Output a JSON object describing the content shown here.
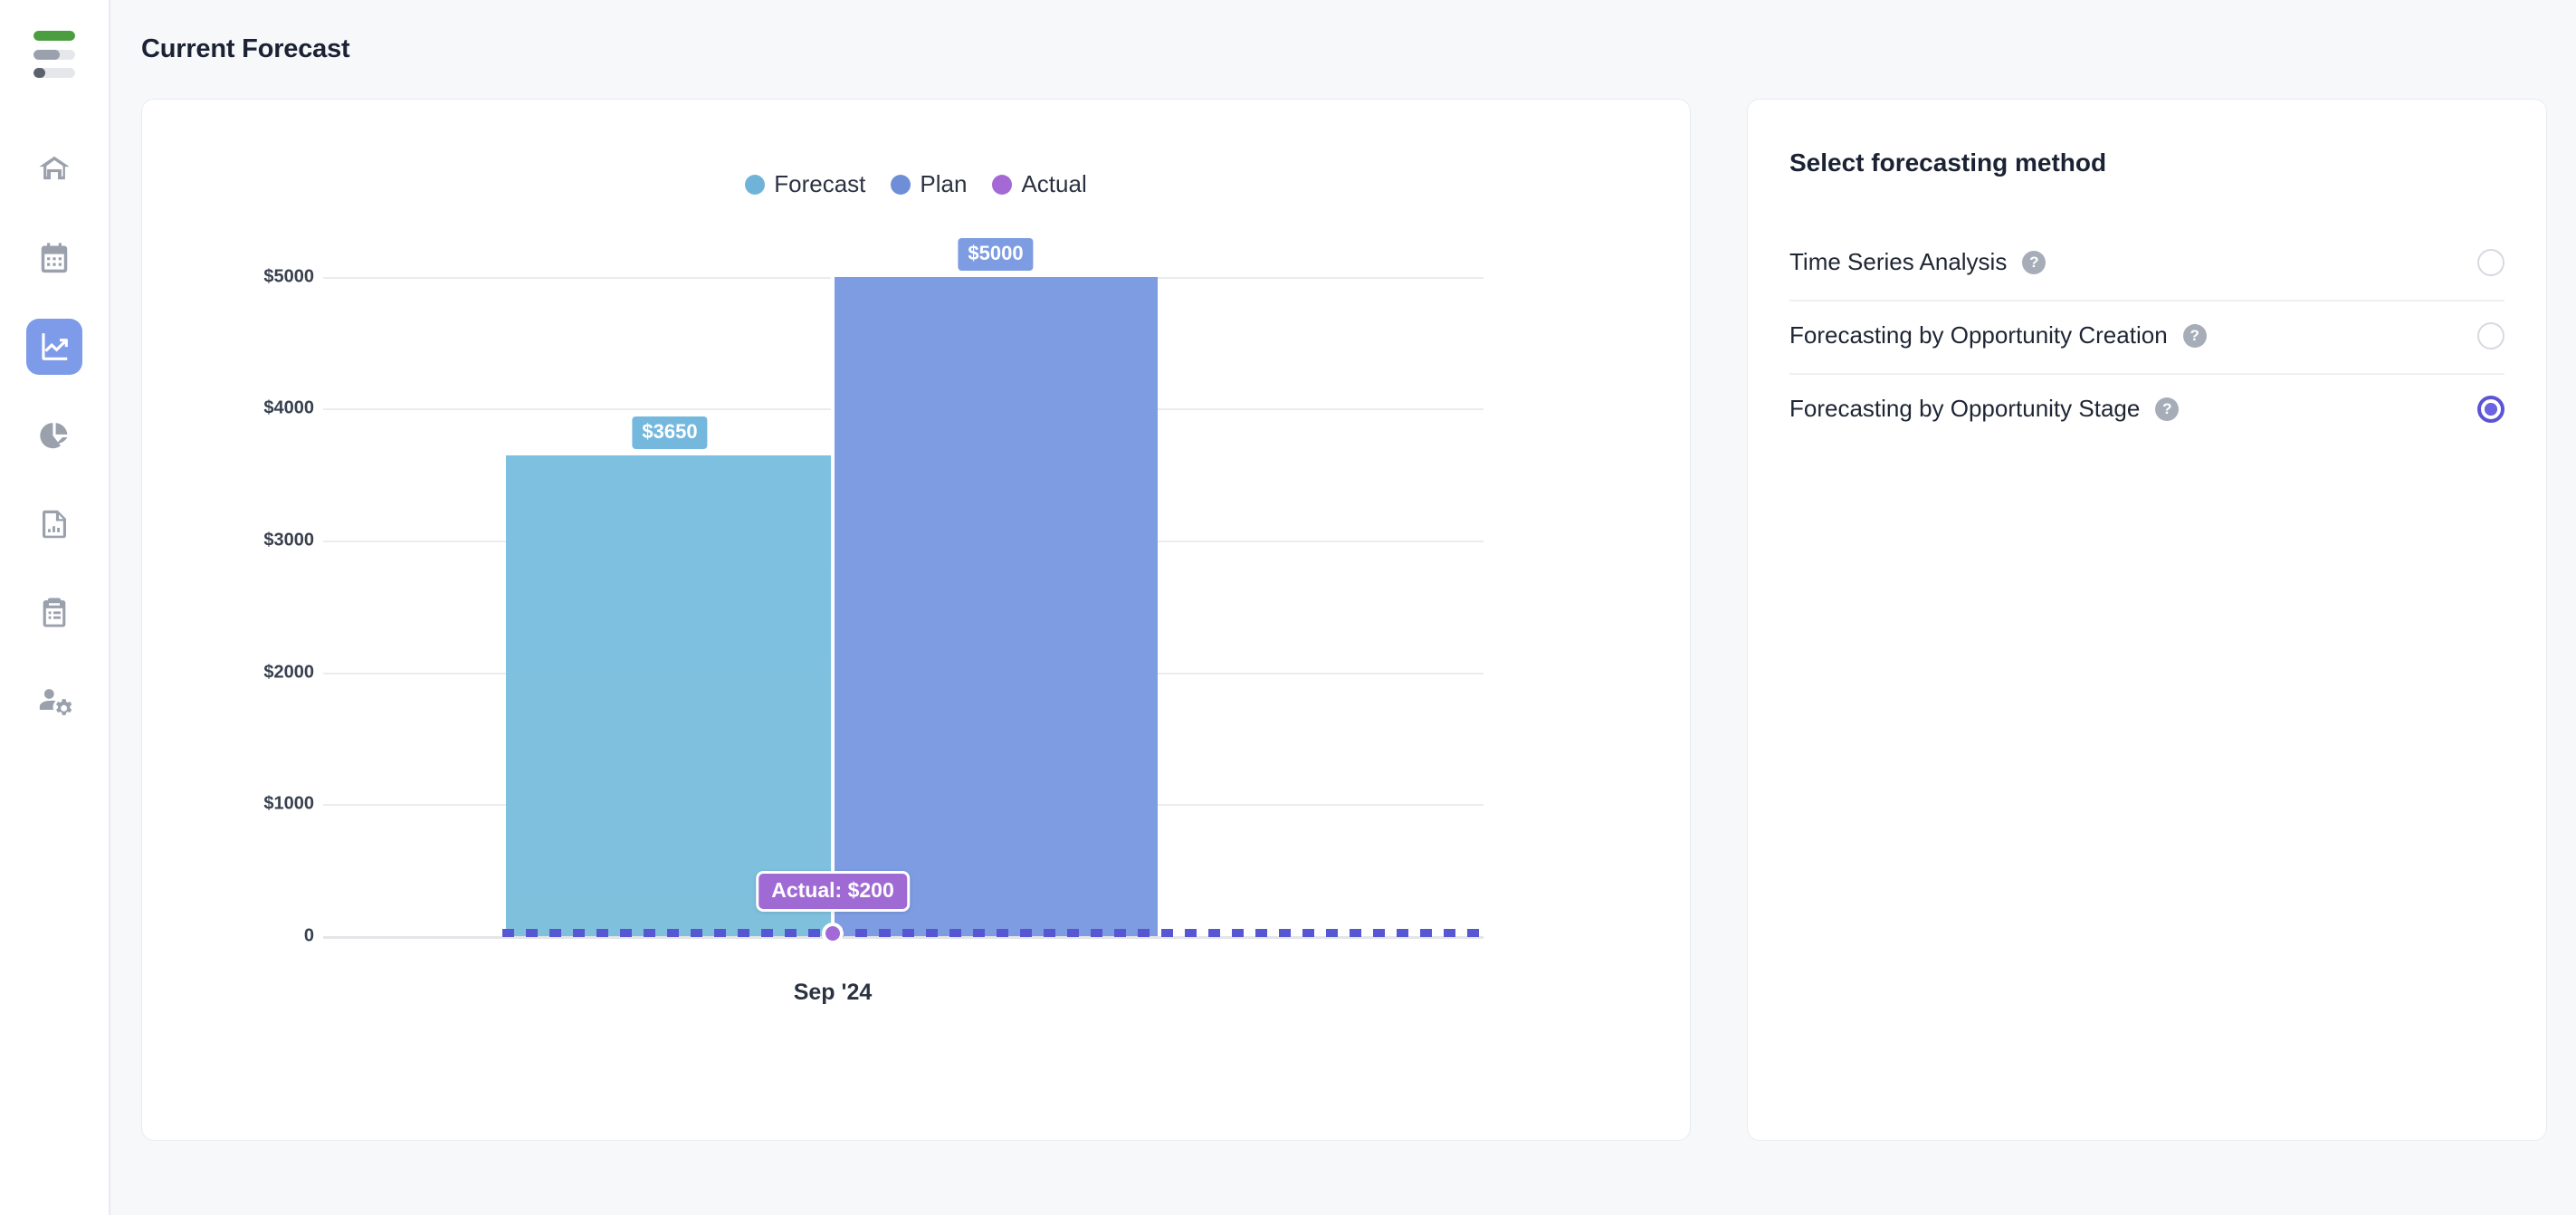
{
  "app": {
    "logo_name": "stacked-bars-logo",
    "logo_colors": [
      "#4a9e3f",
      "#9aa1ac",
      "#5c626d"
    ]
  },
  "sidebar": {
    "items": [
      {
        "id": "home",
        "label": "Home",
        "icon": "home-icon",
        "active": false
      },
      {
        "id": "calendar",
        "label": "Calendar",
        "icon": "calendar-icon",
        "active": false
      },
      {
        "id": "forecast",
        "label": "Forecast",
        "icon": "line-chart-icon",
        "active": true
      },
      {
        "id": "analytics",
        "label": "Analytics",
        "icon": "pie-chart-icon",
        "active": false
      },
      {
        "id": "reports",
        "label": "Reports",
        "icon": "report-doc-icon",
        "active": false
      },
      {
        "id": "tasks",
        "label": "Tasks",
        "icon": "clipboard-icon",
        "active": false
      },
      {
        "id": "admin",
        "label": "Admin",
        "icon": "user-settings-icon",
        "active": false
      }
    ]
  },
  "header": {
    "title": "Current Forecast"
  },
  "chart_data": {
    "type": "bar",
    "title": "",
    "xlabel": "",
    "ylabel": "",
    "categories": [
      "Sep '24"
    ],
    "x_tick_labels": [
      "Sep '24"
    ],
    "y_tick_labels": [
      "$5000",
      "$4000",
      "$3000",
      "$2000",
      "$1000",
      "0"
    ],
    "y_tick_values": [
      5000,
      4000,
      3000,
      2000,
      1000,
      0
    ],
    "ylim": [
      0,
      5400
    ],
    "grid": true,
    "legend_position": "top-center",
    "legend": [
      {
        "name": "Forecast",
        "color": "#6fb4d8"
      },
      {
        "name": "Plan",
        "color": "#6e8fd8"
      },
      {
        "name": "Actual",
        "color": "#a569d6"
      }
    ],
    "series": [
      {
        "name": "Forecast",
        "values": [
          3650
        ],
        "labels": [
          "$3650"
        ],
        "color": "#7dc0e0"
      },
      {
        "name": "Plan",
        "values": [
          5000
        ],
        "labels": [
          "$5000"
        ],
        "color": "#7d9ce2"
      },
      {
        "name": "Actual",
        "values": [
          200
        ],
        "labels": [
          "$200"
        ],
        "color": "#a369d6",
        "render": "dashed-line"
      }
    ],
    "annotations": [
      {
        "type": "tooltip",
        "text": "Actual: $200",
        "series": "Actual",
        "category": "Sep '24",
        "value": 200
      }
    ]
  },
  "method_panel": {
    "title": "Select forecasting method",
    "help_glyph": "?",
    "options": [
      {
        "id": "time-series-analysis",
        "label": "Time Series Analysis",
        "selected": false
      },
      {
        "id": "opportunity-creation",
        "label": "Forecasting by Opportunity Creation",
        "selected": false
      },
      {
        "id": "opportunity-stage",
        "label": "Forecasting by Opportunity Stage",
        "selected": true
      }
    ],
    "accent_color": "#5b54d6"
  }
}
